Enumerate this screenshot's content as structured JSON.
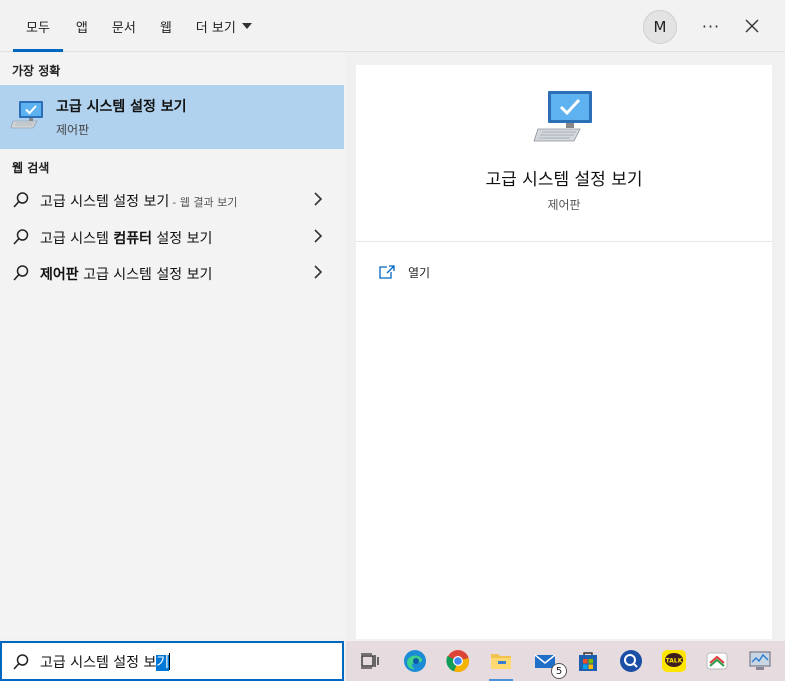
{
  "header": {
    "tabs": [
      {
        "label": "모두",
        "active": true
      },
      {
        "label": "앱"
      },
      {
        "label": "문서"
      },
      {
        "label": "웹"
      },
      {
        "label": "더 보기"
      }
    ],
    "avatar_initial": "M",
    "more_label": "···"
  },
  "left": {
    "best_match_title": "가장 정확",
    "best_match": {
      "title": "고급 시스템 설정 보기",
      "subtitle": "제어판",
      "icon": "computer-check-icon"
    },
    "web_title": "웹 검색",
    "web_results": [
      {
        "text": "고급 시스템 설정 보기",
        "hint": "- 웹 결과 보기"
      },
      {
        "text": "고급 시스템 컴퓨터 설정 보기",
        "bold": "컴퓨터"
      },
      {
        "bold_prefix": "제어판",
        "text": " 고급 시스템 설정 보기"
      }
    ]
  },
  "right": {
    "title": "고급 시스템 설정 보기",
    "subtitle": "제어판",
    "actions": [
      {
        "label": "열기",
        "icon": "open-icon"
      }
    ]
  },
  "search": {
    "typed": "고급 시스템 설정 보",
    "selected": "기"
  },
  "taskbar": {
    "icons": [
      "task-view-icon",
      "edge-icon",
      "chrome-icon",
      "file-explorer-icon",
      "mail-icon",
      "store-icon",
      "search-app-icon",
      "kakaotalk-icon",
      "app-icon",
      "system-monitor-icon"
    ],
    "mail_badge": "5",
    "kakao_label": "TALK"
  },
  "colors": {
    "accent": "#0067c0",
    "selection": "#b1d2ee",
    "taskbar": "#e6dcdf"
  }
}
